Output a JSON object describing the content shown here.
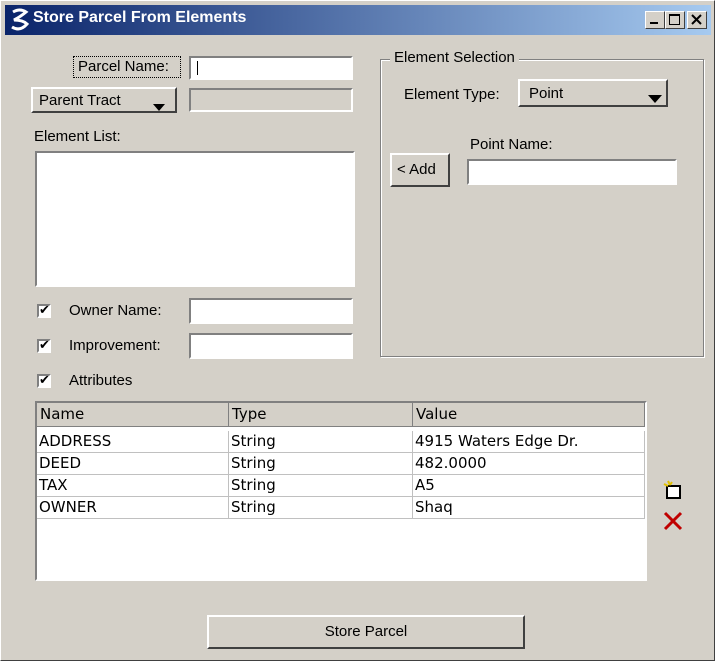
{
  "window": {
    "title": "Store Parcel From Elements"
  },
  "form": {
    "parcel_name_label": "Parcel Name:",
    "parcel_name_value": "",
    "parent_tract_label": "Parent Tract",
    "element_list_label": "Element List:",
    "owner_name_label": "Owner Name:",
    "owner_name_checked": true,
    "improvement_label": "Improvement:",
    "improvement_checked": true,
    "attributes_label": "Attributes",
    "attributes_checked": true
  },
  "element_selection": {
    "group_label": "Element Selection",
    "element_type_label": "Element Type:",
    "element_type_value": "Point",
    "add_label": "< Add",
    "point_name_label": "Point Name:"
  },
  "attributes_table": {
    "columns": [
      "Name",
      "Type",
      "Value"
    ],
    "rows": [
      [
        "ADDRESS",
        "String",
        "4915 Waters Edge Dr."
      ],
      [
        "DEED",
        "String",
        "482.0000"
      ],
      [
        "TAX",
        "String",
        "A5"
      ],
      [
        "OWNER",
        "String",
        "Shaq"
      ]
    ]
  },
  "icons": [
    "new-attribute-icon",
    "delete-attribute-icon"
  ],
  "footer": {
    "store_label": "Store Parcel"
  }
}
